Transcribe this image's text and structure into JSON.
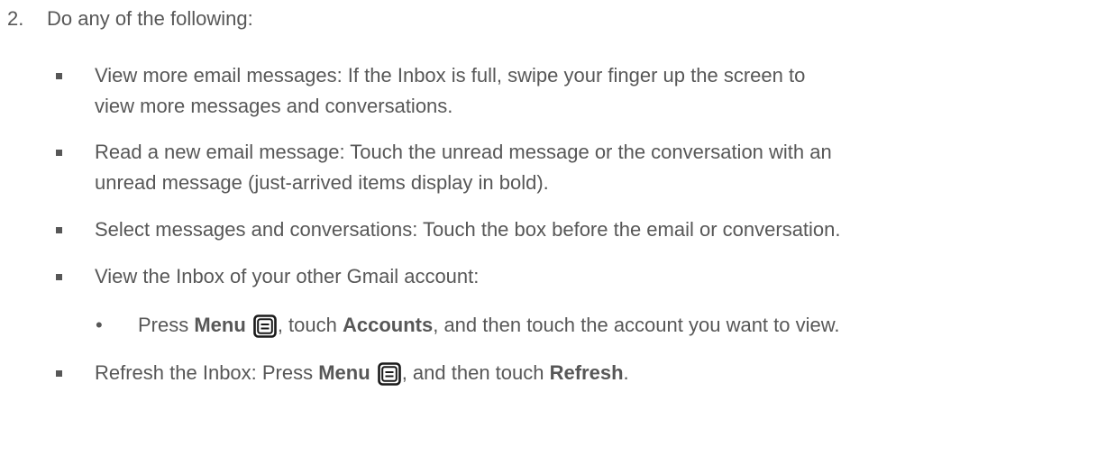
{
  "step": {
    "number": "2.",
    "text": "Do any of the following:"
  },
  "items": [
    {
      "lines": [
        "View more email messages: If the Inbox is full, swipe your finger up the screen to",
        "view more messages and conversations."
      ]
    },
    {
      "lines": [
        "Read a new email message: Touch the unread message or the conversation with an",
        "unread message (just-arrived items display in bold)."
      ]
    },
    {
      "lines": [
        "Select messages and conversations: Touch the box before the email or conversation."
      ]
    },
    {
      "lines": [
        "View the Inbox of your other Gmail account:"
      ]
    }
  ],
  "sub_item": {
    "bullet": "•",
    "t1": "Press ",
    "b1": "Menu",
    "t2": ", touch ",
    "b2": "Accounts",
    "t3": ", and then touch the account you want to view."
  },
  "last_item": {
    "t1": "Refresh the Inbox: Press ",
    "b1": "Menu",
    "t2": ", and then touch ",
    "b2": "Refresh",
    "t3": "."
  },
  "icons": {
    "menu_key": "menu-key-icon",
    "bullet_square": "square-bullet-icon"
  },
  "colors": {
    "text": "#575757",
    "icon_stroke": "#1a1a1a"
  }
}
